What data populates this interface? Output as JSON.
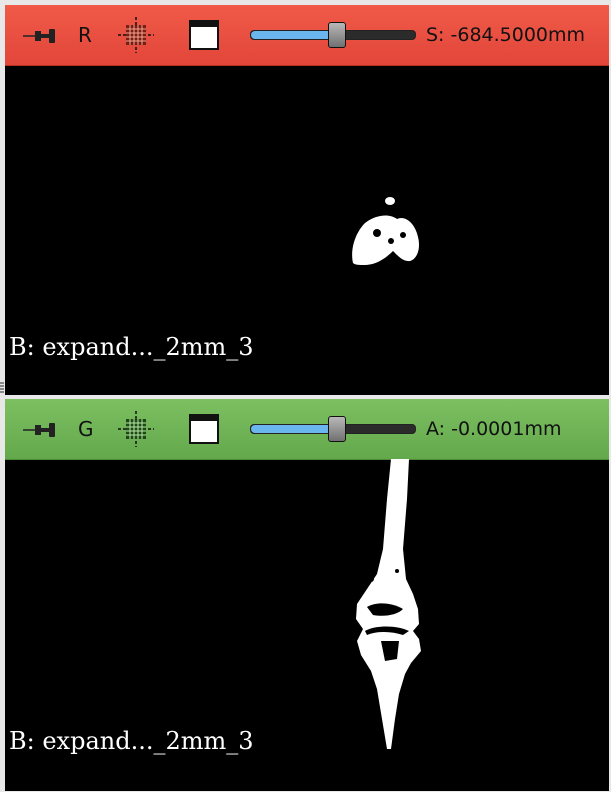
{
  "views": {
    "red": {
      "name": "R",
      "color": "#e2463a",
      "offset_text": "S: -684.5000mm",
      "slider_fraction": 0.52,
      "volume_label": "B: expand..._2mm_3"
    },
    "green": {
      "name": "G",
      "color": "#63a84b",
      "offset_text": "A: -0.0001mm",
      "slider_fraction": 0.52,
      "volume_label": "B: expand..._2mm_3"
    }
  },
  "icons": {
    "pin": "pin-icon",
    "labelmap": "labelmap-grid-icon",
    "window": "window-layout-icon"
  }
}
